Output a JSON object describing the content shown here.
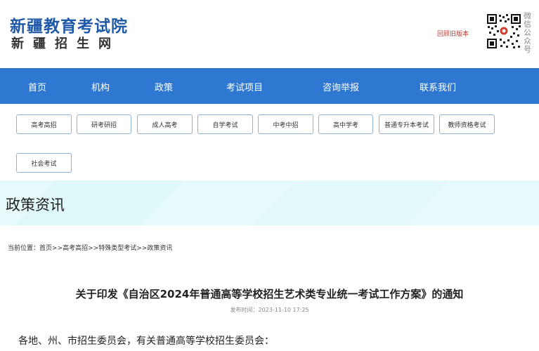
{
  "header": {
    "logo_title": "新疆教育考试院",
    "logo_subtitle": "新疆招生网",
    "old_version_link": "回顾旧版本",
    "qr_caption": "微信公众号"
  },
  "nav": {
    "items": [
      {
        "label": "首页"
      },
      {
        "label": "机构"
      },
      {
        "label": "政策"
      },
      {
        "label": "考试项目"
      },
      {
        "label": "咨询举报"
      },
      {
        "label": "联系我们"
      }
    ]
  },
  "categories": [
    {
      "label": "高考高招"
    },
    {
      "label": "研考研招"
    },
    {
      "label": "成人高考"
    },
    {
      "label": "自学考试"
    },
    {
      "label": "中考中招"
    },
    {
      "label": "高中学考"
    },
    {
      "label": "普通专升本考试"
    },
    {
      "label": "教师资格考试"
    },
    {
      "label": "社会考试"
    }
  ],
  "banner": {
    "title": "政策资讯"
  },
  "breadcrumb": {
    "prefix": "当前位置：",
    "items": [
      "首页",
      "高考高招",
      "特殊类型考试",
      "政策资讯"
    ],
    "separator": ">>"
  },
  "article": {
    "title": "关于印发《自治区2024年普通高等学校招生艺术类专业统一考试工作方案》的通知",
    "publish_label": "发布时间：",
    "publish_time": "2023-11-10 17:25",
    "first_line": "各地、州、市招生委员会，有关普通高等学校招生委员会："
  },
  "colors": {
    "nav_bg": "#2f78d1",
    "logo_blue": "#1f59a8",
    "banner_bg": "#e8fbfd",
    "old_version_red": "#c0392b"
  }
}
